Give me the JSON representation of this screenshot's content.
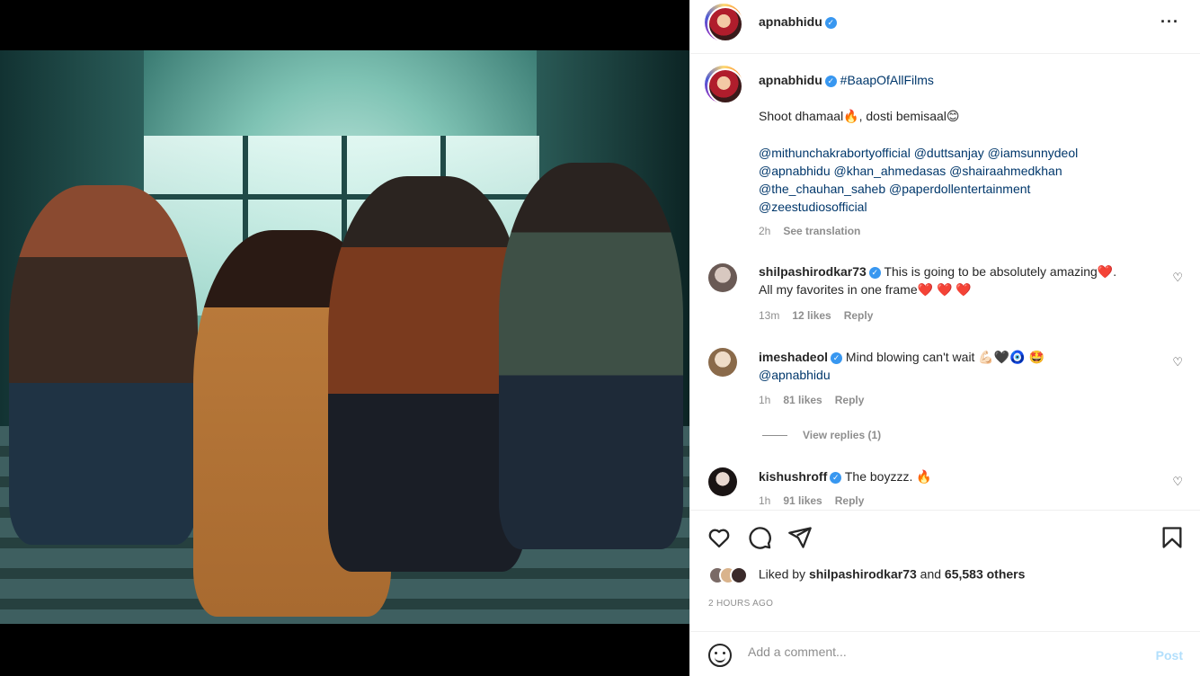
{
  "post": {
    "author": "apnabhidu",
    "hashtag": "#BaapOfAllFilms",
    "caption_line1": "Shoot dhamaal🔥, dosti bemisaal😊",
    "mentions": [
      "@mithunchakrabortyofficial @duttsanjay @iamsunnydeol",
      "@apnabhidu @khan_ahmedasas @shairaahmedkhan",
      "@the_chauhan_saheb @paperdollentertainment",
      "@zeestudiosofficial"
    ],
    "caption_time": "2h",
    "see_translation": "See translation",
    "more_icon": "more-icon"
  },
  "comments": [
    {
      "user": "shilpashirodkar73",
      "text": "This is going to be absolutely amazing❤️.",
      "text2": "All my favorites in one frame❤️ ❤️ ❤️",
      "time": "13m",
      "likes": "12 likes",
      "reply": "Reply"
    },
    {
      "user": "imeshadeol",
      "text": "Mind blowing can't wait 💪🏻🖤🧿 🤩",
      "text2": "@apnabhidu",
      "time": "1h",
      "likes": "81 likes",
      "reply": "Reply",
      "view_replies": "View replies (1)"
    },
    {
      "user": "kishushroff",
      "text": "The boyzzz. 🔥",
      "time": "1h",
      "likes": "91 likes",
      "reply": "Reply"
    }
  ],
  "liked_by": {
    "prefix": "Liked by ",
    "user": "shilpashirodkar73",
    "and": " and ",
    "count": "65,583 others"
  },
  "timestamp": "2 HOURS AGO",
  "add_comment": {
    "placeholder": "Add a comment...",
    "post_label": "Post"
  },
  "icons": {
    "like": "heart-icon",
    "comment": "comment-icon",
    "share": "paper-plane-icon",
    "save": "bookmark-icon",
    "emoji": "smiley-icon"
  },
  "colors": {
    "link": "#00376b",
    "verified": "#3897f0",
    "muted": "#8e8e8e",
    "post_disabled": "#b2dffc"
  }
}
